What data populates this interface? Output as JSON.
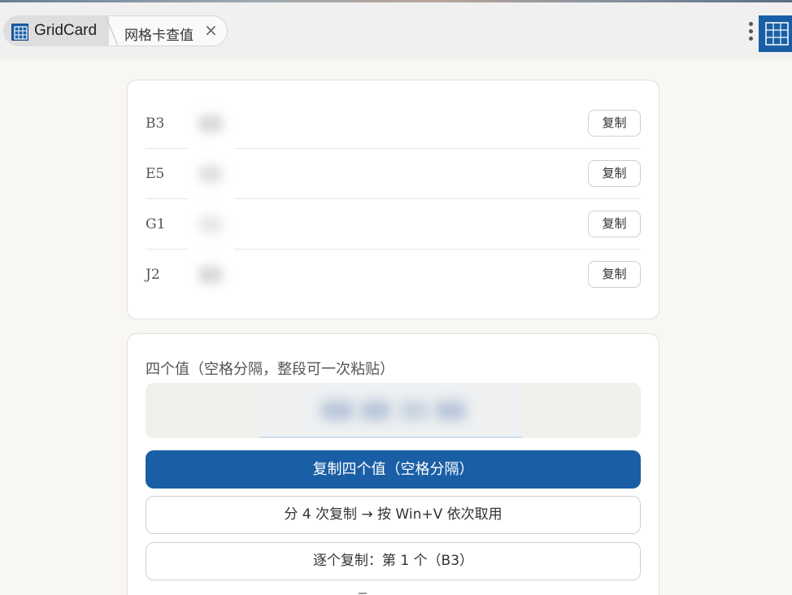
{
  "tabs": {
    "app_name": "GridCard",
    "page_tab_label": "网格卡查值",
    "close_glyph": "×"
  },
  "accent_color": "#1a5fa6",
  "cells": [
    {
      "label": "B3",
      "copy_label": "复制"
    },
    {
      "label": "E5",
      "copy_label": "复制"
    },
    {
      "label": "G1",
      "copy_label": "复制"
    },
    {
      "label": "J2",
      "copy_label": "复制"
    }
  ],
  "combined": {
    "title": "四个值（空格分隔，整段可一次粘贴）",
    "copy_all_label": "复制四个值（空格分隔）",
    "copy_split_label": "分 4 次复制 → 按 Win+V 依次取用",
    "copy_each_label": "逐个复制：第 1 个（B3）"
  }
}
